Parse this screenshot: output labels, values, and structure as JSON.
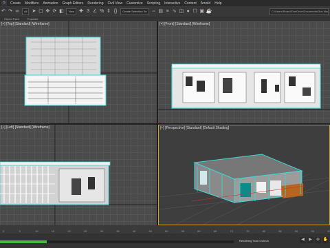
{
  "menu": [
    "Create",
    "Modifiers",
    "Animation",
    "Graph Editors",
    "Rendering",
    "Civil View",
    "Customize",
    "Scripting",
    "Interactive",
    "Content",
    "Arnold",
    "Help"
  ],
  "toolbar": {
    "filter_value": "All",
    "view_value": "View",
    "selection_set_placeholder": "Create Selection Se",
    "project_path": "C:\\Users\\Roard\\OneDrive\\Documents\\3ds Max"
  },
  "subtabs": [
    "Object Paint",
    "Populate"
  ],
  "viewports": {
    "top_left": "[+] [Top] [Standard] [Wireframe]",
    "top_right": "[+] [Front] [Standard] [Wireframe]",
    "bottom_left": "[+] [Left] [Standard] [Wireframe]",
    "bottom_right": "[+] [Perspective] [Standard] [Default Shading]"
  },
  "timeline_ticks": [
    "0",
    "5",
    "10",
    "15",
    "20",
    "25",
    "30",
    "35",
    "40",
    "45",
    "50",
    "55",
    "60",
    "65",
    "70",
    "75",
    "80",
    "85",
    "90",
    "95",
    "100"
  ],
  "status_text": "Rendering Time 0:00:00",
  "progress": 0.2,
  "colors": {
    "accent": "#c9a227",
    "progress": "#3fbf3f",
    "wire_white": "#ffffff",
    "wire_cyan": "#3fd7d7"
  }
}
